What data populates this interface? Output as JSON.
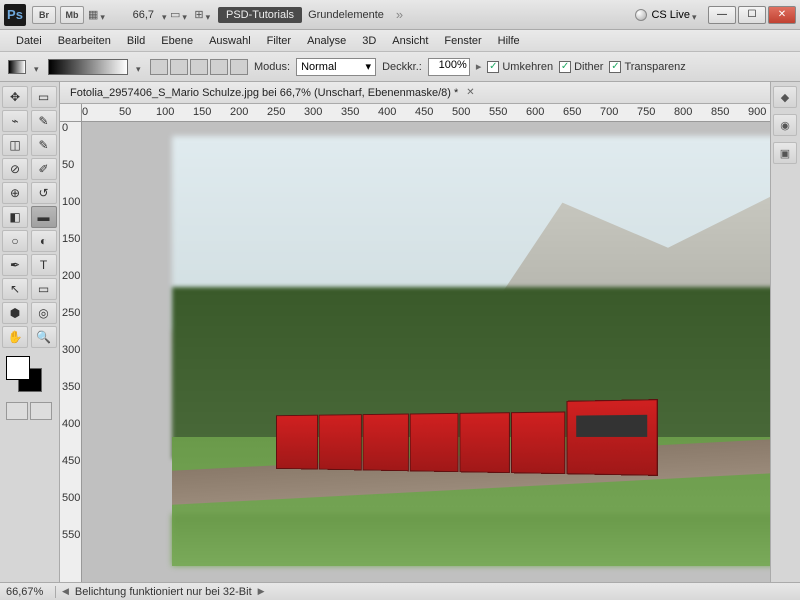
{
  "titlebar": {
    "zoom": "66,7",
    "workspace_btn": "PSD-Tutorials",
    "workspace_text": "Grundelemente",
    "cs_live": "CS Live"
  },
  "menu": {
    "items": [
      "Datei",
      "Bearbeiten",
      "Bild",
      "Ebene",
      "Auswahl",
      "Filter",
      "Analyse",
      "3D",
      "Ansicht",
      "Fenster",
      "Hilfe"
    ]
  },
  "options": {
    "mode_label": "Modus:",
    "mode_value": "Normal",
    "opacity_label": "Deckkr.:",
    "opacity_value": "100%",
    "reverse": "Umkehren",
    "dither": "Dither",
    "transparency": "Transparenz"
  },
  "document": {
    "tab": "Fotolia_2957406_S_Mario Schulze.jpg bei 66,7%  (Unscharf, Ebenenmaske/8) *"
  },
  "ruler_h": [
    "0",
    "50",
    "100",
    "150",
    "200",
    "250",
    "300",
    "350",
    "400",
    "450",
    "500",
    "550",
    "600",
    "650",
    "700",
    "750",
    "800",
    "850",
    "900"
  ],
  "ruler_v": [
    "0",
    "50",
    "100",
    "150",
    "200",
    "250",
    "300",
    "350",
    "400",
    "450",
    "500",
    "550"
  ],
  "status": {
    "zoom": "66,67%",
    "info": "Belichtung funktioniert nur bei 32-Bit"
  }
}
